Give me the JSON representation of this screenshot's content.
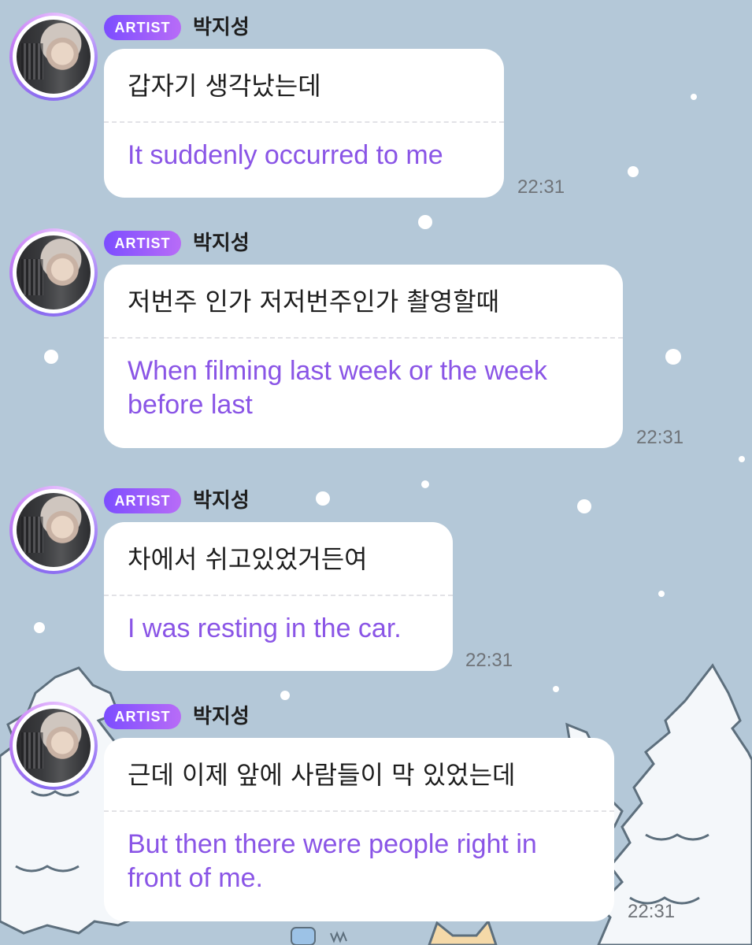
{
  "messages": [
    {
      "badge": "ARTIST",
      "name": "박지성",
      "korean": "갑자기 생각났는데",
      "english": "It suddenly occurred to me",
      "time": "22:31"
    },
    {
      "badge": "ARTIST",
      "name": "박지성",
      "korean": "저번주 인가 저저번주인가 촬영할때",
      "english": "When filming last week or the week before last",
      "time": "22:31"
    },
    {
      "badge": "ARTIST",
      "name": "박지성",
      "korean": "차에서 쉬고있었거든여",
      "english": "I was resting in the car.",
      "time": "22:31"
    },
    {
      "badge": "ARTIST",
      "name": "박지성",
      "korean": "근데 이제 앞에 사람들이 막 있었는데",
      "english": "But then there were people right in front of me.",
      "time": "22:31"
    }
  ],
  "colors": {
    "background": "#b4c8d8",
    "badge_gradient_start": "#7c4dff",
    "badge_gradient_end": "#b86cf7",
    "translation_text": "#8a55e6",
    "bubble": "#ffffff"
  },
  "background_icons": [
    "snowflake-dots",
    "snowy-pine-trees",
    "cat-ears"
  ]
}
